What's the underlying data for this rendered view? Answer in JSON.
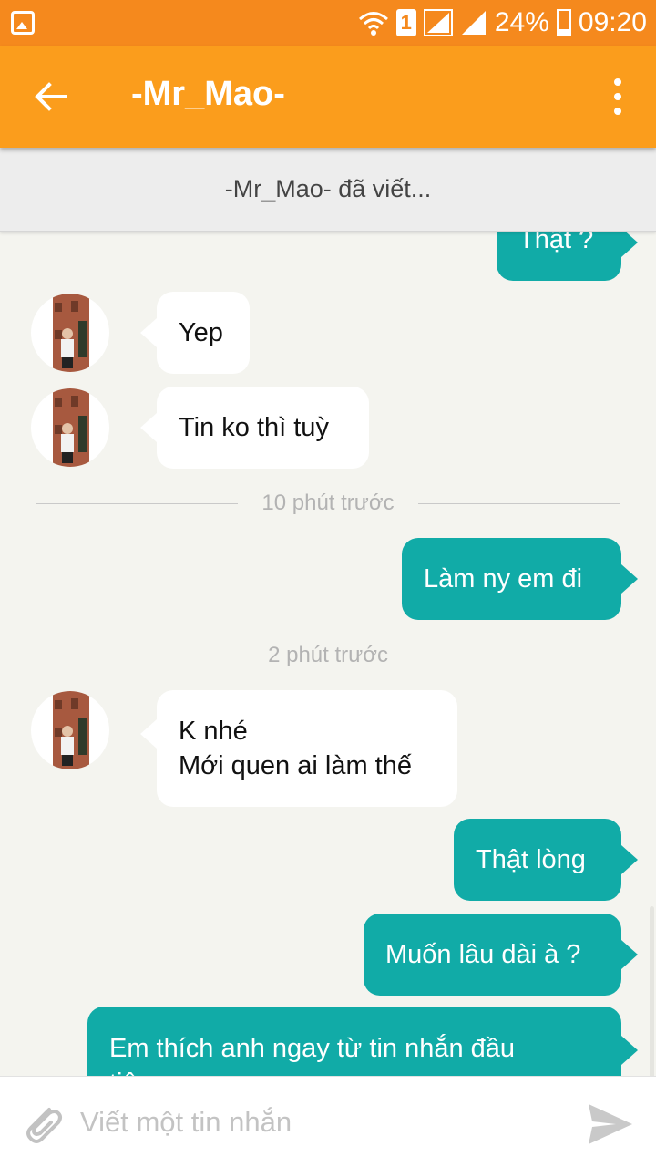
{
  "status_bar": {
    "battery": "24%",
    "time": "09:20",
    "sim": "1"
  },
  "toolbar": {
    "title": "-Mr_Mao-"
  },
  "typing_indicator": "-Mr_Mao- đã viết...",
  "messages": {
    "m0": "Thật ?",
    "m1": "Yep",
    "m2": "Tin ko thì tuỳ",
    "d1": "10 phút trước",
    "m3": "Làm ny em đi",
    "d2": "2 phút trước",
    "m4_line1": "K nhé",
    "m4_line2": "Mới quen ai làm thế",
    "m5": "Thật lòng",
    "m6": "Muốn lâu dài à ?",
    "m7_line1": "Em thích anh ngay từ tin nhắn đầu",
    "m7_line2": "tiên..."
  },
  "composer": {
    "placeholder": "Viết một tin nhắn"
  },
  "colors": {
    "status_bar": "#f5891d",
    "toolbar": "#fb9d1c",
    "sent_bubble": "#11aba7",
    "received_bubble": "#ffffff",
    "background": "#f4f4ef"
  },
  "icons": {
    "status": [
      "image-icon",
      "wifi-icon",
      "sim-icon",
      "signal-icon",
      "battery-icon"
    ],
    "toolbar": [
      "back-arrow-icon",
      "more-vert-icon"
    ],
    "composer": [
      "attach-icon",
      "send-icon"
    ]
  }
}
